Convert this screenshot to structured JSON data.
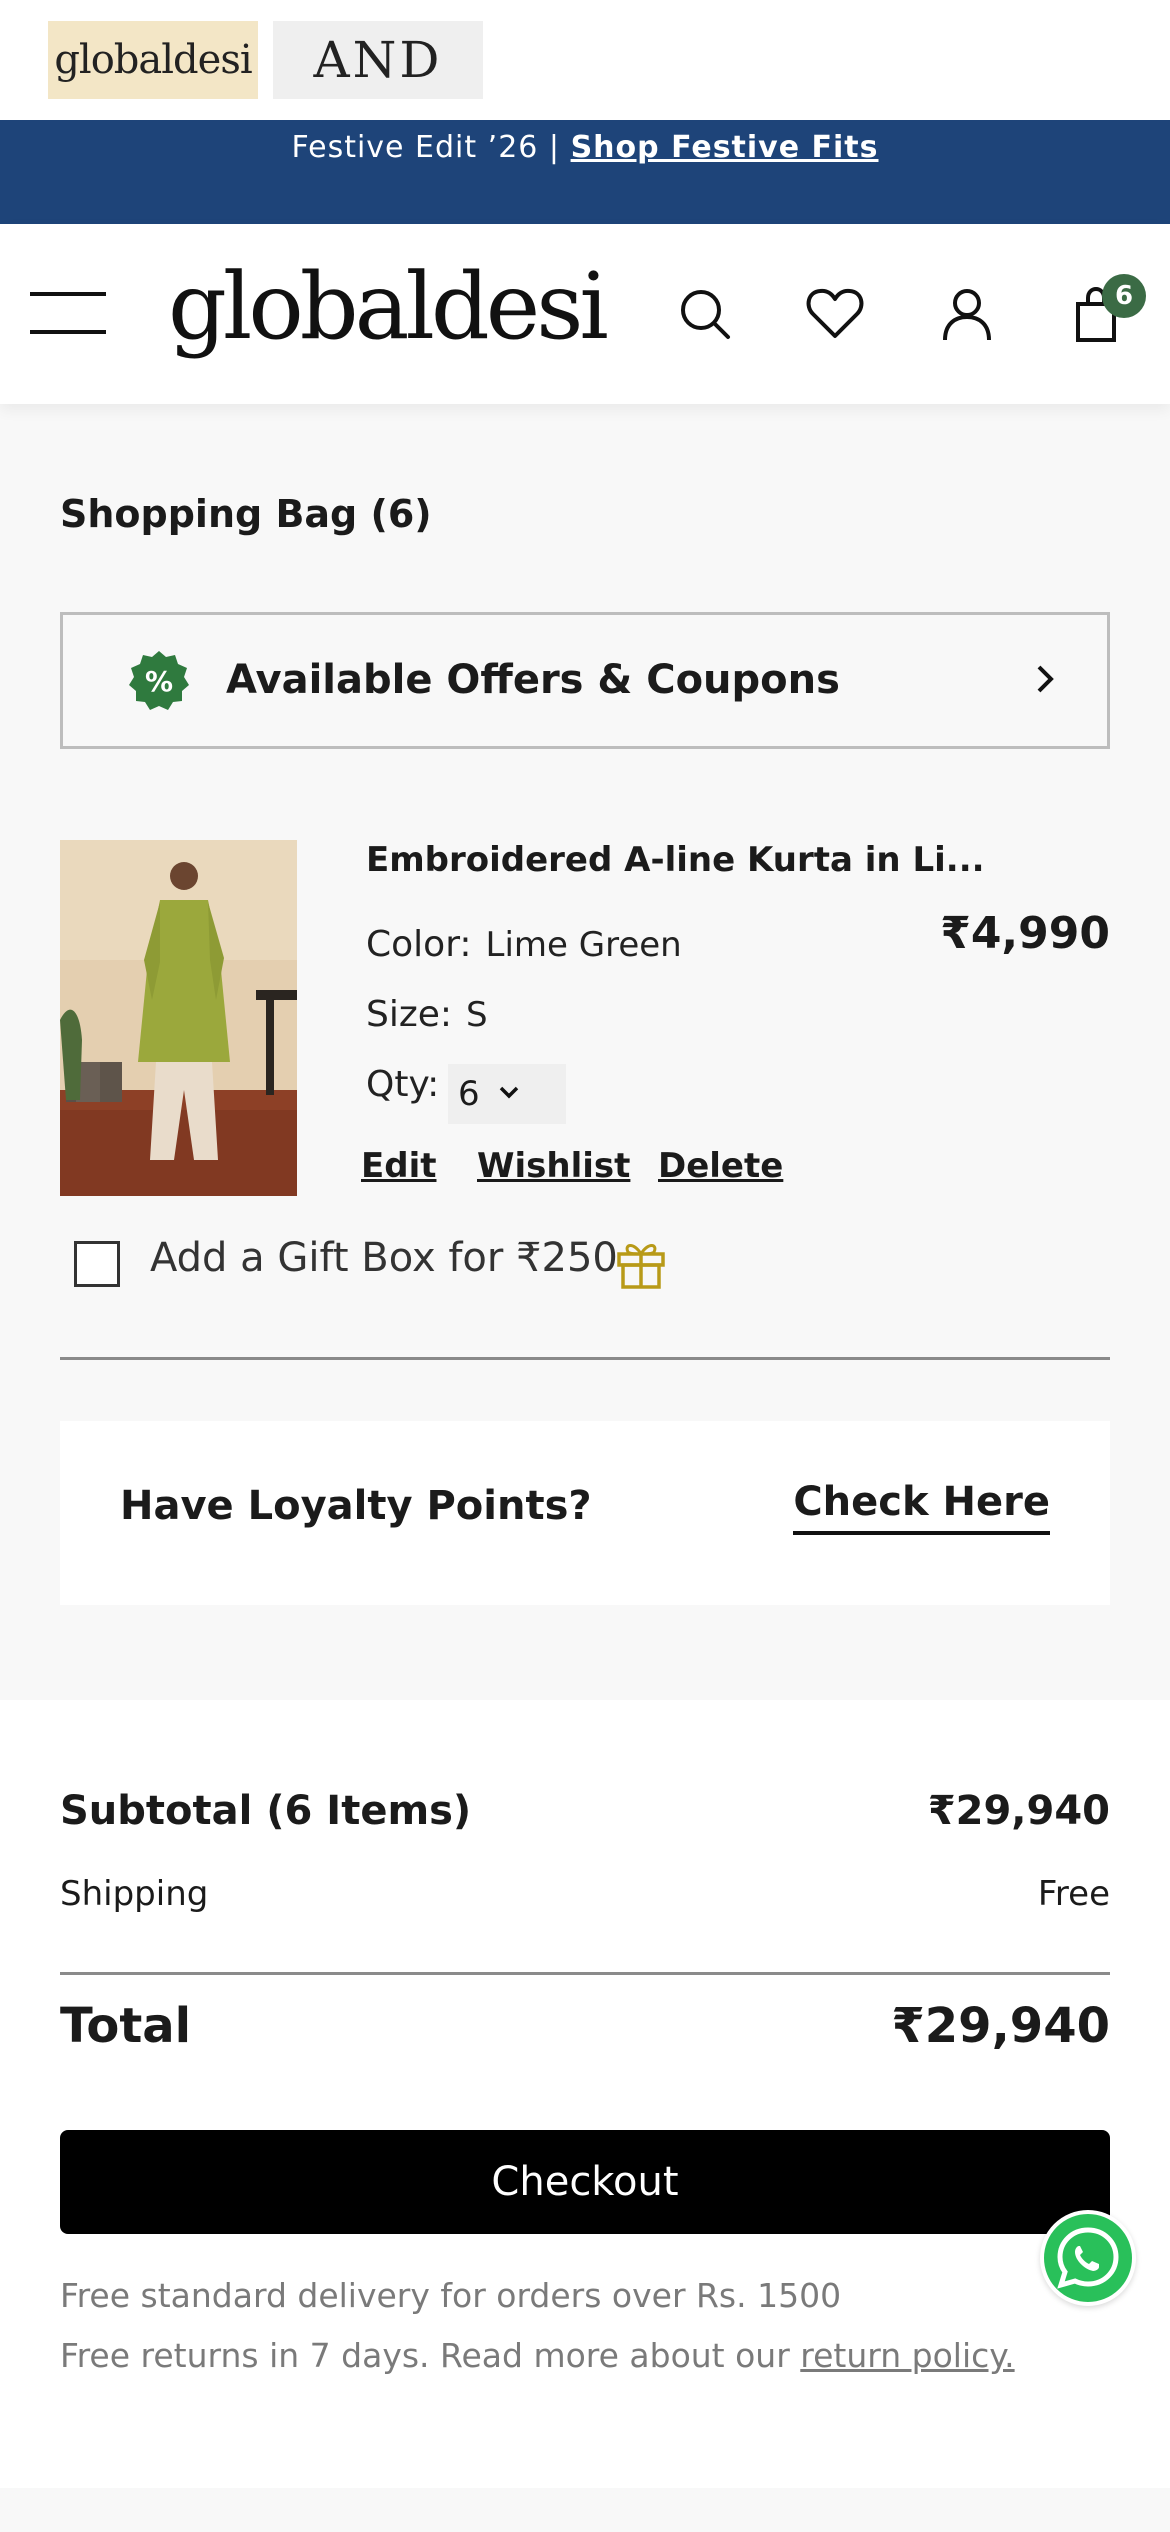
{
  "brand_tabs": {
    "primary": "globaldesi",
    "secondary": "AND"
  },
  "promo": {
    "text": "Festive Edit ’26 | ",
    "link": "Shop Festive Fits"
  },
  "header": {
    "logo": "globaldesi",
    "cart_count": "6"
  },
  "bag": {
    "title": "Shopping Bag (6)",
    "offers_label": "Available Offers & Coupons"
  },
  "item": {
    "name": "Embroidered A-line Kurta in Li...",
    "price": "₹4,990",
    "color_label": "Color:",
    "color_value": "Lime Green",
    "size_label": "Size:",
    "size_value": "S",
    "qty_label": "Qty:",
    "qty_value": "6",
    "actions": {
      "edit": "Edit",
      "wishlist": "Wishlist",
      "delete": "Delete"
    }
  },
  "gift_box": {
    "label": "Add a Gift Box for ₹250",
    "checked": false
  },
  "loyalty": {
    "title": "Have Loyalty Points?",
    "link": "Check Here"
  },
  "summary": {
    "subtotal_label": "Subtotal (6 Items)",
    "subtotal_value": "₹29,940",
    "shipping_label": "Shipping",
    "shipping_value": "Free",
    "total_label": "Total",
    "total_value": "₹29,940",
    "checkout_label": "Checkout",
    "note_delivery": "Free standard delivery for orders over Rs. 1500",
    "note_returns": "Free returns in 7 days. Read more about our ",
    "note_returns_link": "return policy."
  },
  "colors": {
    "promo_bg": "#1e4479",
    "badge": "#3b6b45",
    "offer_icon": "#2f7a3e",
    "gift_icon": "#b89a18",
    "whatsapp": "#29c05a"
  },
  "icons": [
    "hamburger-icon",
    "search-icon",
    "heart-icon",
    "user-icon",
    "bag-icon",
    "discount-icon",
    "chevron-right-icon",
    "chevron-down-icon",
    "gift-icon",
    "whatsapp-icon"
  ]
}
